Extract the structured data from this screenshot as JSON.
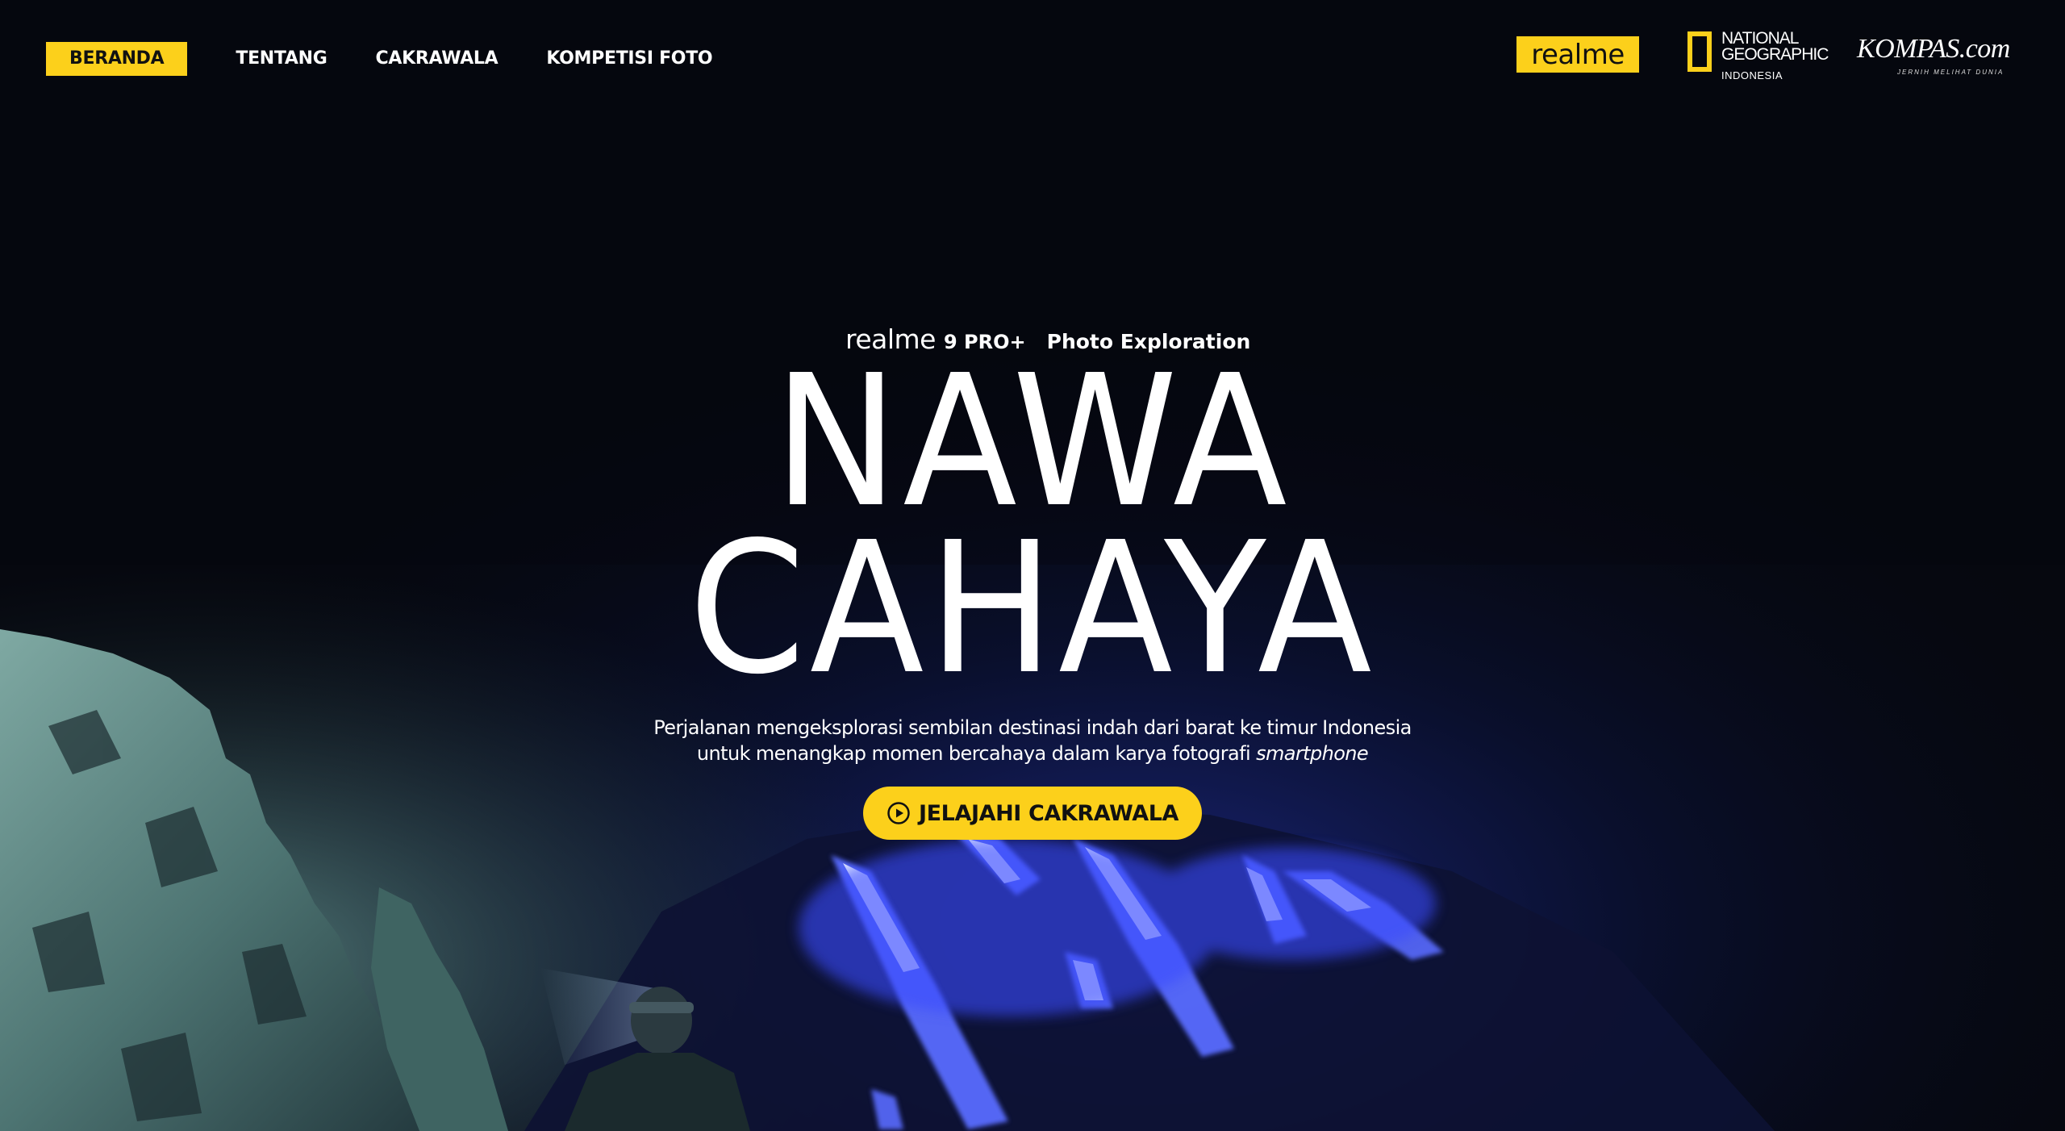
{
  "nav": {
    "items": [
      {
        "label": "BERANDA",
        "active": true
      },
      {
        "label": "TENTANG",
        "active": false
      },
      {
        "label": "CAKRAWALA",
        "active": false
      },
      {
        "label": "KOMPETISI FOTO",
        "active": false
      }
    ]
  },
  "partners": {
    "realme": "realme",
    "natgeo": {
      "line1": "NATIONAL",
      "line2": "GEOGRAPHIC",
      "line3": "INDONESIA"
    },
    "kompas": {
      "name": "KOMPAS.com",
      "tagline": "JERNIH MELIHAT DUNIA"
    }
  },
  "hero": {
    "brand": "realme",
    "model": "9 PRO+",
    "label": "Photo Exploration",
    "title_line1": "NAWA",
    "title_line2": "CAHAYA",
    "description_line1": "Perjalanan mengeksplorasi sembilan destinasi indah dari barat ke timur Indonesia",
    "description_line2": "untuk menangkap momen bercahaya dalam karya fotografi",
    "description_emphasis": "smartphone",
    "cta_label": "JELAJAHI CAKRAWALA"
  },
  "colors": {
    "accent": "#fcd01b",
    "background": "#05070d",
    "blue_fire": "#4a5cff"
  },
  "icons": {
    "cta": "play-circle-icon"
  }
}
